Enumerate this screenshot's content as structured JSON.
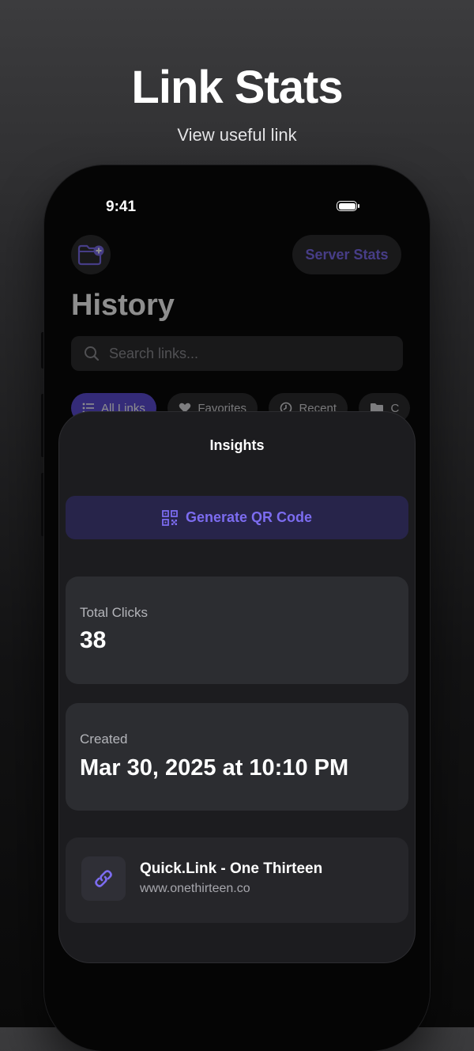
{
  "promo": {
    "title": "Link Stats",
    "subtitle": "View useful link"
  },
  "status_bar": {
    "time": "9:41"
  },
  "background_app": {
    "server_stats_label": "Server Stats",
    "title": "History",
    "search": {
      "placeholder": "Search links...",
      "value": ""
    },
    "filters": [
      {
        "label": "All Links",
        "icon": "list-icon",
        "active": true
      },
      {
        "label": "Favorites",
        "icon": "heart-icon",
        "active": false
      },
      {
        "label": "Recent",
        "icon": "clock-icon",
        "active": false
      },
      {
        "label": "C",
        "icon": "folder-icon",
        "active": false
      }
    ]
  },
  "insights": {
    "title": "Insights",
    "qr_button_label": "Generate QR Code",
    "total_clicks": {
      "label": "Total Clicks",
      "value": "38"
    },
    "created": {
      "label": "Created",
      "value": "Mar 30, 2025 at 10:10 PM"
    },
    "link": {
      "title": "Quick.Link - One Thirteen",
      "url": "www.onethirteen.co",
      "icon": "link-icon"
    }
  },
  "colors": {
    "accent": "#7c6cf0",
    "accent_dark": "#5b4bd6",
    "card": "#2c2d31",
    "sheet": "#1c1c1f"
  }
}
